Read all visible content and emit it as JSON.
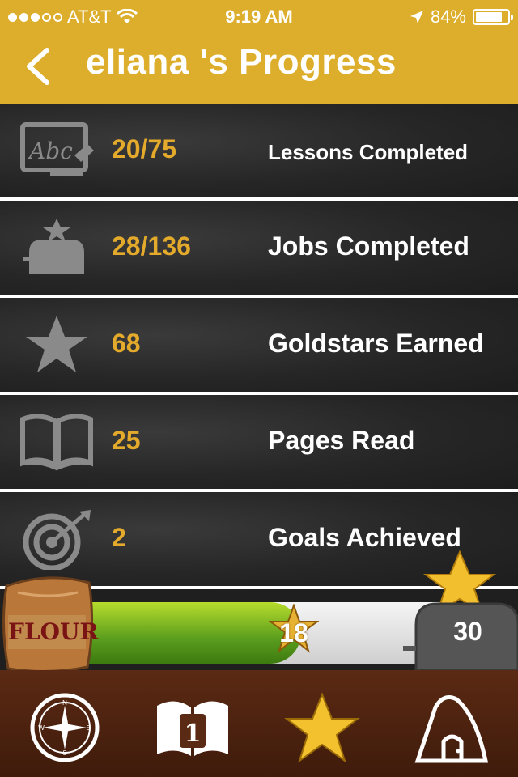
{
  "status": {
    "carrier": "AT&T",
    "time": "9:19 AM",
    "battery": "84%",
    "battery_level": 0.84,
    "signal_bars": 3
  },
  "header": {
    "title": "eliana 's Progress",
    "back_icon": "chevron-left-icon"
  },
  "stats": [
    {
      "icon": "chalkboard-abc-icon",
      "count": "20/75",
      "label": "Lessons Completed"
    },
    {
      "icon": "toaster-star-icon",
      "count": "28/136",
      "label": "Jobs Completed"
    },
    {
      "icon": "star-icon",
      "count": "68",
      "label": "Goldstars Earned"
    },
    {
      "icon": "open-book-icon",
      "count": "25",
      "label": "Pages Read"
    },
    {
      "icon": "target-icon",
      "count": "2",
      "label": "Goals Achieved"
    }
  ],
  "progress": {
    "flour_label": "FLOUR",
    "current_stars": "18",
    "goal_stars": "30",
    "fill_fraction": 0.6
  },
  "tabs": [
    {
      "name": "compass-icon",
      "compass_letters": [
        "N",
        "S",
        "E",
        "W"
      ]
    },
    {
      "name": "book-lesson-icon",
      "badge": "1"
    },
    {
      "name": "star-tab-icon"
    },
    {
      "name": "house-icon"
    }
  ],
  "colors": {
    "header": "#dcae2c",
    "accent": "#e3aa2b",
    "tabbar": "#4a200e"
  }
}
